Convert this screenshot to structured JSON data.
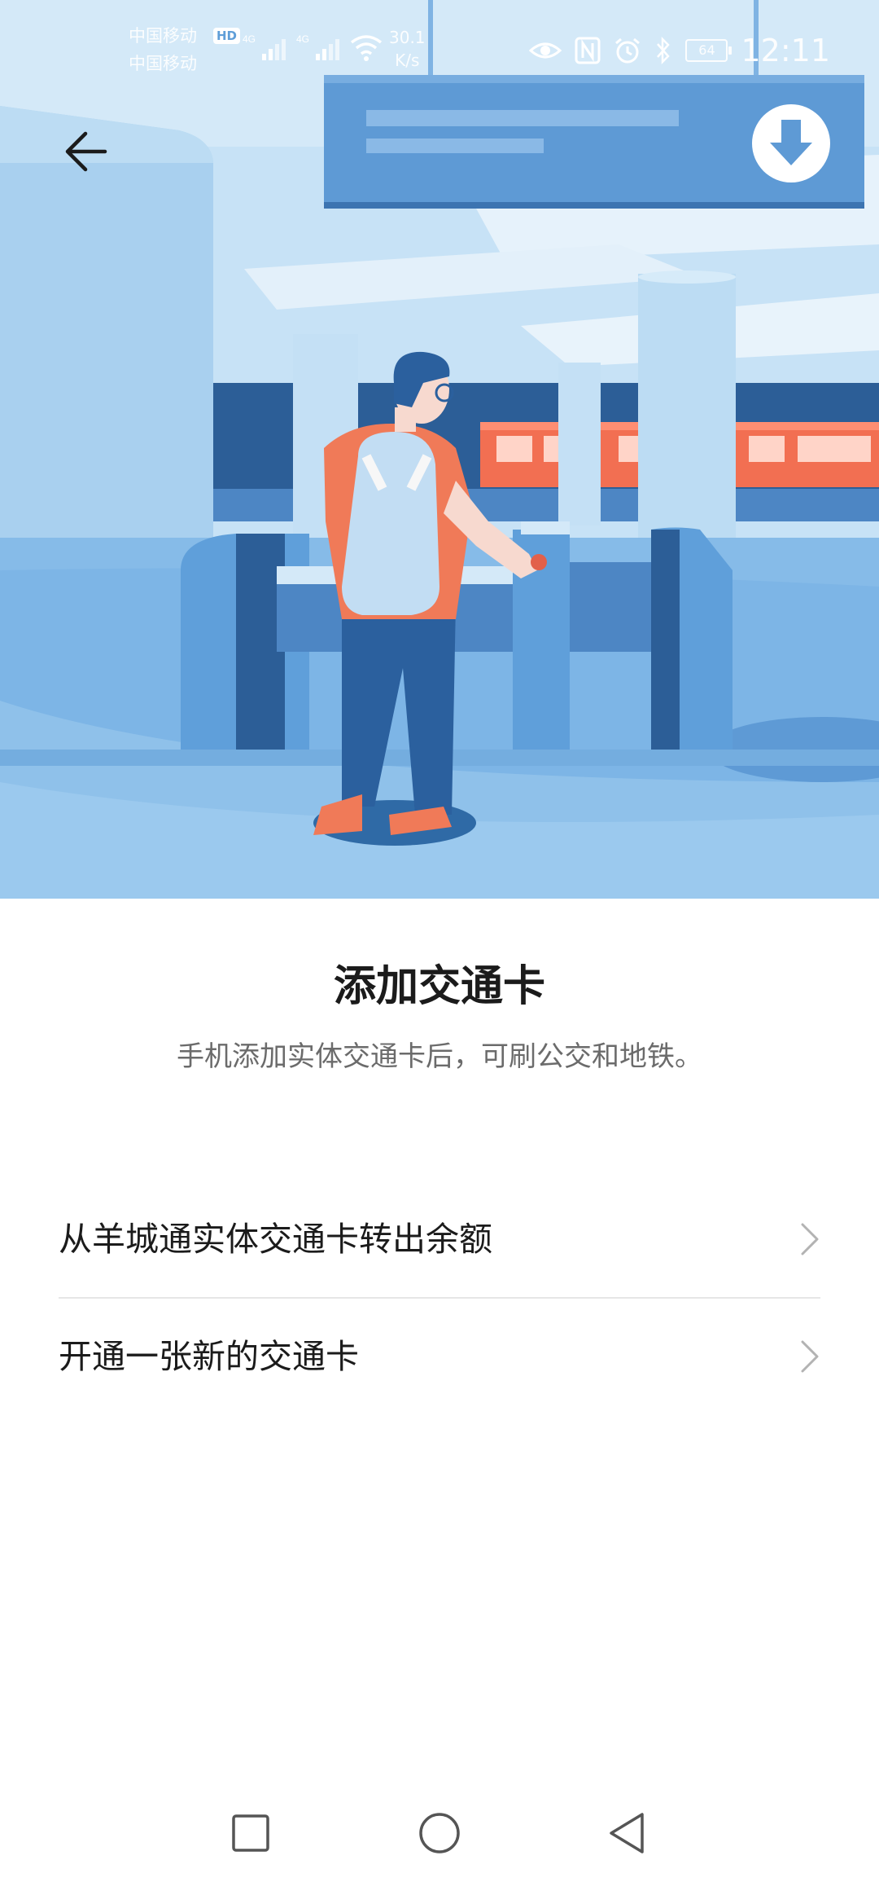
{
  "status_bar": {
    "carrier_1": "中国移动",
    "carrier_2": "中国移动",
    "hd_badge": "HD",
    "net_type_1": "4G",
    "net_type_2": "4G",
    "net_speed_value": "30.1",
    "net_speed_unit": "K/s",
    "battery": "64",
    "time": "12:11",
    "icons": [
      "eye-comfort-icon",
      "nfc-icon",
      "alarm-icon",
      "bluetooth-icon",
      "wifi-icon",
      "signal-icon"
    ]
  },
  "header": {
    "back_icon": "arrow-left-icon"
  },
  "hero": {
    "description_icon": "download-arrow-icon"
  },
  "main": {
    "title": "添加交通卡",
    "subtitle": "手机添加实体交通卡后，可刷公交和地铁。"
  },
  "options": [
    {
      "label": "从羊城通实体交通卡转出余额",
      "icon": "chevron-right-icon"
    },
    {
      "label": "开通一张新的交通卡",
      "icon": "chevron-right-icon"
    }
  ],
  "nav_bar": {
    "recent_icon": "square-recents-icon",
    "home_icon": "circle-home-icon",
    "back_icon": "triangle-back-icon"
  },
  "colors": {
    "sky": "#c5e0f4",
    "accent_blue": "#5f9fda",
    "dark_blue": "#2a5d95",
    "shirt": "#f07a58",
    "text_primary": "#1b1b1b",
    "text_secondary": "#6b6b6b"
  }
}
